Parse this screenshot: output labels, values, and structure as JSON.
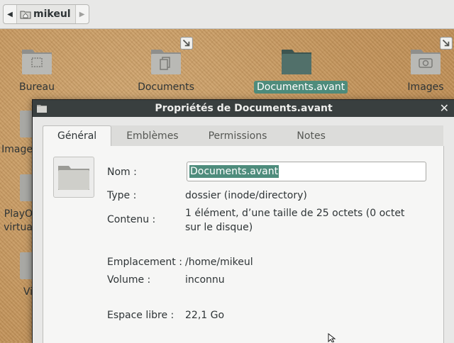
{
  "pathbar": {
    "location": "mikeul"
  },
  "desktop": {
    "icons": [
      {
        "label": "Bureau"
      },
      {
        "label": "Documents"
      },
      {
        "label": "Documents.avant",
        "selected": true
      },
      {
        "label": "Images"
      }
    ],
    "partial_labels": [
      "Image",
      "PlayO",
      "virtua",
      "Vi"
    ]
  },
  "dialog": {
    "title": "Propriétés de Documents.avant",
    "tabs": [
      "Général",
      "Emblèmes",
      "Permissions",
      "Notes"
    ],
    "active_tab": "Général",
    "fields": {
      "name_label": "Nom :",
      "name_value": "Documents.avant",
      "type_label": "Type :",
      "type_value": "dossier (inode/directory)",
      "contents_label": "Contenu :",
      "contents_value": "1 élément, d’une taille de 25 octets (0 octet sur le disque)",
      "location_label": "Emplacement :",
      "location_value": "/home/mikeul",
      "volume_label": "Volume :",
      "volume_value": "inconnu",
      "free_label": "Espace libre :",
      "free_value": "22,1 Go"
    }
  },
  "colors": {
    "selection": "#4e8c7c",
    "titlebar": "#393f3f",
    "desktop": "#c99d66"
  }
}
